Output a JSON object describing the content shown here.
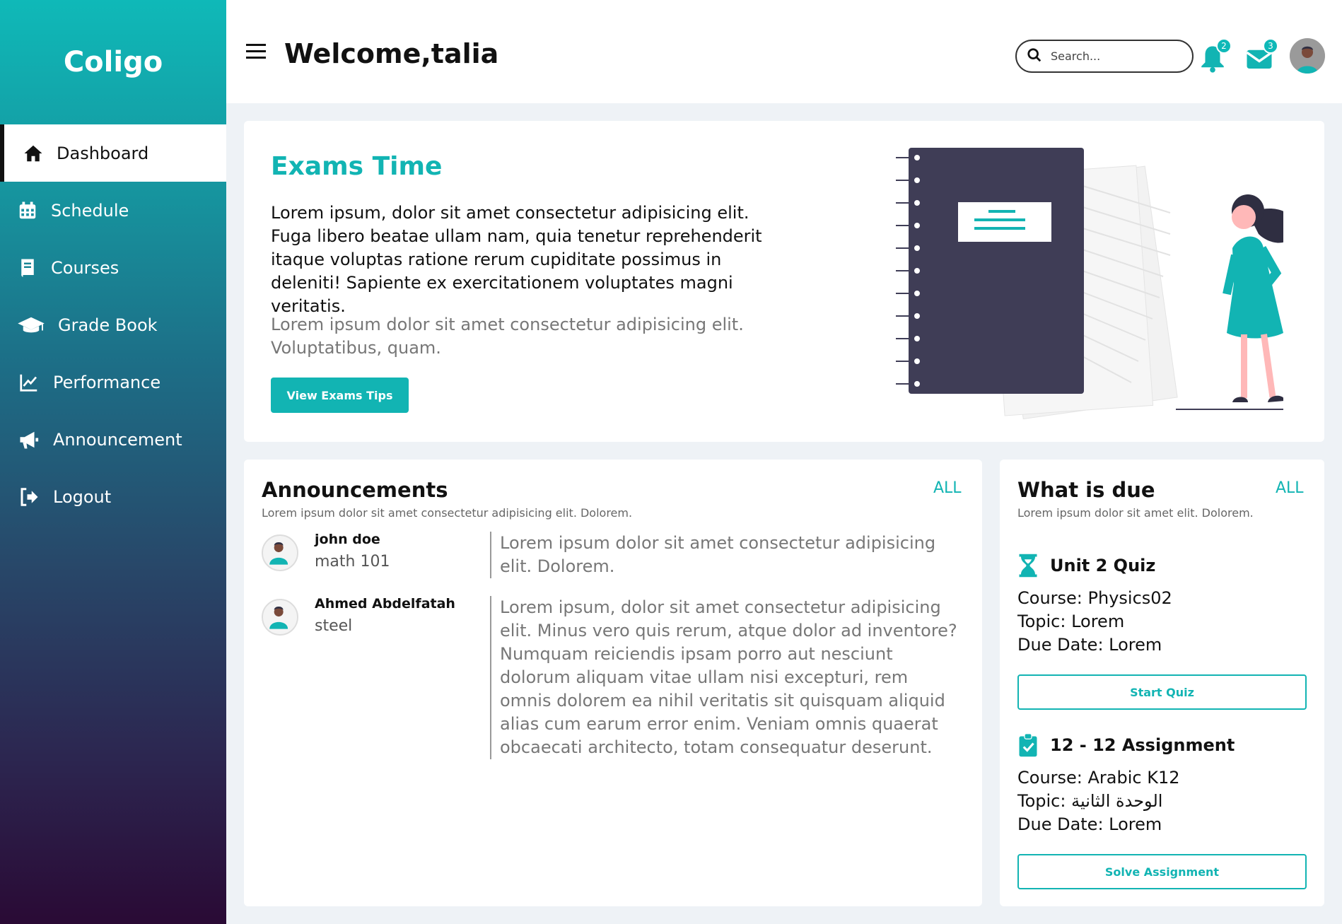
{
  "brand": "Coligo",
  "sidebar": {
    "items": [
      {
        "label": "Dashboard"
      },
      {
        "label": "Schedule"
      },
      {
        "label": "Courses"
      },
      {
        "label": "Grade Book"
      },
      {
        "label": "Performance"
      },
      {
        "label": "Announcement"
      },
      {
        "label": "Logout"
      }
    ]
  },
  "header": {
    "welcome": "Welcome,talia",
    "search_placeholder": "Search...",
    "notifications_count": "2",
    "messages_count": "3"
  },
  "hero": {
    "title": "Exams Time",
    "paragraph1": "Lorem ipsum, dolor sit amet consectetur adipisicing elit. Fuga libero beatae ullam nam, quia tenetur reprehenderit itaque voluptas ratione rerum cupiditate possimus in deleniti! Sapiente ex exercitationem voluptates magni veritatis.",
    "paragraph2": "Lorem ipsum dolor sit amet consectetur adipisicing elit. Voluptatibus, quam.",
    "button": "View Exams Tips"
  },
  "announcements": {
    "title": "Announcements",
    "subtitle": "Lorem ipsum dolor sit amet consectetur adipisicing elit. Dolorem.",
    "all_label": "ALL",
    "items": [
      {
        "name": "john doe",
        "course": "math 101",
        "text": "Lorem ipsum dolor sit amet consectetur adipisicing elit. Dolorem."
      },
      {
        "name": "Ahmed Abdelfatah",
        "course": "steel",
        "text": "Lorem ipsum, dolor sit amet consectetur adipisicing elit. Minus vero quis rerum, atque dolor ad inventore? Numquam reiciendis ipsam porro aut nesciunt dolorum aliquam vitae ullam nisi excepturi, rem omnis dolorem ea nihil veritatis sit quisquam aliquid alias cum earum error enim. Veniam omnis quaerat obcaecati architecto, totam consequatur deserunt."
      }
    ]
  },
  "due": {
    "title": "What is due",
    "subtitle": "Lorem ipsum dolor sit amet elit. Dolorem.",
    "all_label": "ALL",
    "items": [
      {
        "title": "Unit 2 Quiz",
        "course": "Course: Physics02",
        "topic": "Topic: Lorem",
        "due_date": "Due Date: Lorem",
        "button": "Start Quiz"
      },
      {
        "title": "12 - 12 Assignment",
        "course": "Course: Arabic K12",
        "topic": "Topic: الوحدة الثانية",
        "due_date": "Due Date: Lorem",
        "button": "Solve Assignment"
      }
    ]
  },
  "colors": {
    "accent": "#12b4b3",
    "dark_notebook": "#3f3d56"
  }
}
